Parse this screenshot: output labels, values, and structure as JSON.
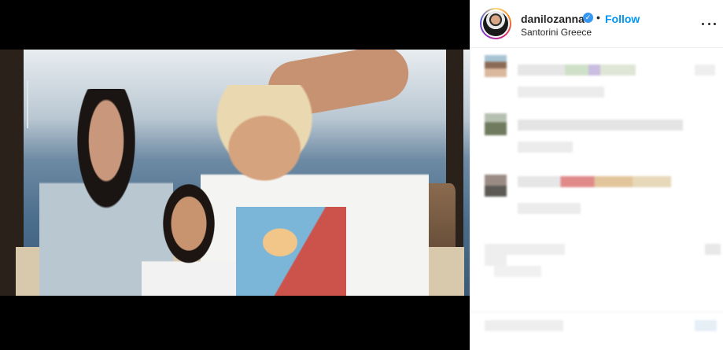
{
  "post": {
    "username": "danilozanna",
    "verified_glyph": "✓",
    "separator": "•",
    "follow_label": "Follow",
    "location": "Santorini Greece"
  },
  "icons": {
    "more": "more-options-icon",
    "verified": "verified-badge-icon"
  },
  "colors": {
    "follow_blue": "#0095f6",
    "verified_blue": "#3897f0",
    "text": "#262626",
    "media_background": "#000000"
  }
}
